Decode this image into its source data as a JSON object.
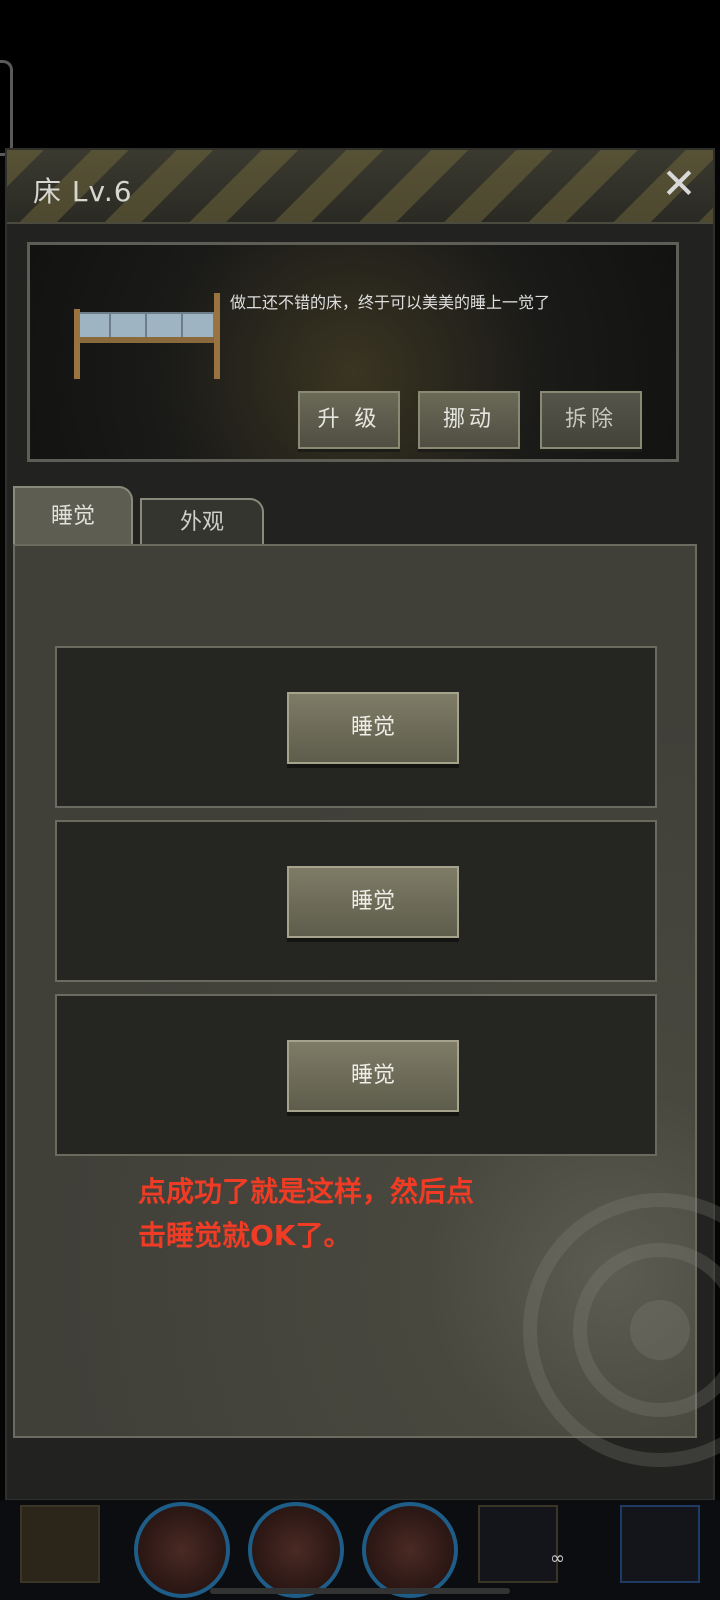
{
  "dialog": {
    "title": "床 Lv.6",
    "close_label": "✕",
    "description": "做工还不错的床，终于可以美美的睡上一觉了",
    "actions": {
      "upgrade": "升 级",
      "move": "挪动",
      "dismantle": "拆除"
    }
  },
  "tabs": [
    {
      "label": "睡觉",
      "active": true
    },
    {
      "label": "外观",
      "active": false
    }
  ],
  "slots": [
    {
      "button": "睡觉"
    },
    {
      "button": "睡觉"
    },
    {
      "button": "睡觉"
    }
  ],
  "annotation": {
    "text_line1": "点成功了就是这样，然后点",
    "text_line2": "击睡觉就OK了。"
  },
  "bottom": {
    "infinity": "∞"
  },
  "colors": {
    "annotation": "#f03b25",
    "panel": "#222320",
    "button": "#6b6a58",
    "ring": "#1e5d88"
  }
}
